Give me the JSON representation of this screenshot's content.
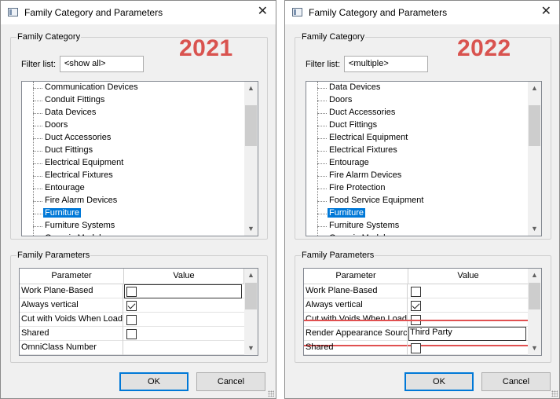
{
  "left": {
    "title": "Family Category and Parameters",
    "year": "2021",
    "family_category_legend": "Family Category",
    "filter_label": "Filter list:",
    "filter_value": "<show all>",
    "categories": [
      "Communication Devices",
      "Conduit Fittings",
      "Data Devices",
      "Doors",
      "Duct Accessories",
      "Duct Fittings",
      "Electrical Equipment",
      "Electrical Fixtures",
      "Entourage",
      "Fire Alarm Devices",
      "Furniture",
      "Furniture Systems",
      "Generic Models"
    ],
    "selected_category": "Furniture",
    "family_parameters_legend": "Family Parameters",
    "col_parameter": "Parameter",
    "col_value": "Value",
    "parameters": [
      {
        "name": "Work Plane-Based",
        "type": "checkbox",
        "checked": false,
        "editing": true
      },
      {
        "name": "Always vertical",
        "type": "checkbox",
        "checked": true
      },
      {
        "name": "Cut with Voids When Loaded",
        "type": "checkbox",
        "checked": false
      },
      {
        "name": "Shared",
        "type": "checkbox",
        "checked": false
      },
      {
        "name": "OmniClass Number",
        "type": "text",
        "value": ""
      }
    ],
    "ok_label": "OK",
    "cancel_label": "Cancel"
  },
  "right": {
    "title": "Family Category and Parameters",
    "year": "2022",
    "family_category_legend": "Family Category",
    "filter_label": "Filter list:",
    "filter_value": "<multiple>",
    "categories": [
      "Data Devices",
      "Doors",
      "Duct Accessories",
      "Duct Fittings",
      "Electrical Equipment",
      "Electrical Fixtures",
      "Entourage",
      "Fire Alarm Devices",
      "Fire Protection",
      "Food Service Equipment",
      "Furniture",
      "Furniture Systems",
      "Generic Models"
    ],
    "selected_category": "Furniture",
    "family_parameters_legend": "Family Parameters",
    "col_parameter": "Parameter",
    "col_value": "Value",
    "parameters": [
      {
        "name": "Work Plane-Based",
        "type": "checkbox",
        "checked": false
      },
      {
        "name": "Always vertical",
        "type": "checkbox",
        "checked": true
      },
      {
        "name": "Cut with Voids When Loaded",
        "type": "checkbox",
        "checked": false
      },
      {
        "name": "Render Appearance Source",
        "type": "text",
        "value": "Third Party",
        "editing": true,
        "highlighted": true
      },
      {
        "name": "Shared",
        "type": "checkbox",
        "checked": false
      }
    ],
    "ok_label": "OK",
    "cancel_label": "Cancel"
  },
  "colors": {
    "selection": "#0078d7",
    "year_text": "#d9534f",
    "highlight_border": "#e05050",
    "ok_border": "#0078d7"
  },
  "icons": {
    "app": "dialog-window-icon",
    "close": "close-icon",
    "dropdown": "chevron-down-icon",
    "scroll_up": "scroll-up-arrow-icon",
    "scroll_down": "scroll-down-arrow-icon"
  }
}
